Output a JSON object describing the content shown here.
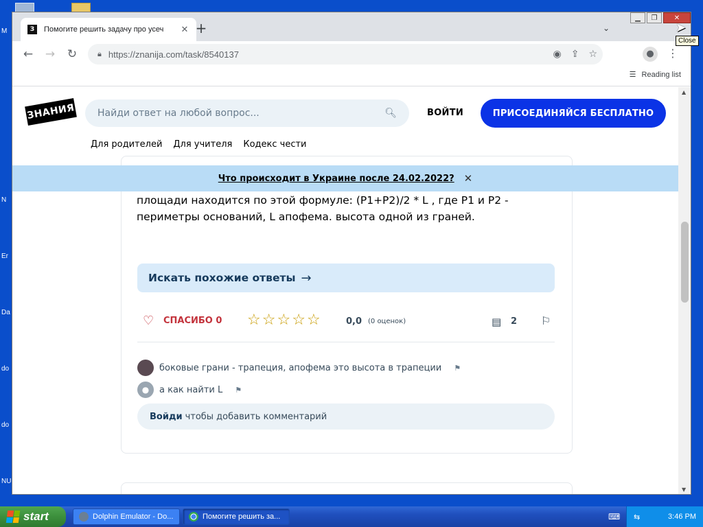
{
  "desktop": {
    "labels": [
      "M",
      "N",
      "Er",
      "Da",
      "do",
      "do",
      "NU"
    ]
  },
  "browser": {
    "tab_title": "Помогите решить задачу про усеч",
    "tab_favicon": "З",
    "new_tab": "+",
    "url": "https://znanija.com/task/8540137",
    "reading_list": "Reading list",
    "close_tooltip": "Close"
  },
  "site": {
    "logo": "ЗНАНИЯ",
    "search_placeholder": "Найди ответ на любой вопрос...",
    "login": "ВОЙТИ",
    "join": "ПРИСОЕДИНЯЙСЯ БЕСПЛАТНО",
    "subnav": [
      "Для родителей",
      "Для учителя",
      "Кодекс чести"
    ],
    "banner": "Что происходит в Украине после 24.02.2022?"
  },
  "answer": {
    "text": "площади находится по этой формуле: (P1+P2)/2 * L , где P1 и P2 - периметры оснований, L апофема. высота одной из граней.",
    "similar": "Искать похожие ответы",
    "thanks": "СПАСИБО 0",
    "rating": "0,0",
    "rating_count": "(0 оценок)",
    "comments_count": "2",
    "stars": 0
  },
  "comments": [
    {
      "text": "боковые грани - трапеция, апофема это высота в трапеции"
    },
    {
      "text": "а как найти L"
    }
  ],
  "add_comment": {
    "link": "Войди",
    "rest": "чтобы добавить комментарий"
  },
  "taskbar": {
    "start": "start",
    "items": [
      "Dolphin Emulator - Do...",
      "Помогите решить за..."
    ],
    "time": "3:46 PM"
  }
}
